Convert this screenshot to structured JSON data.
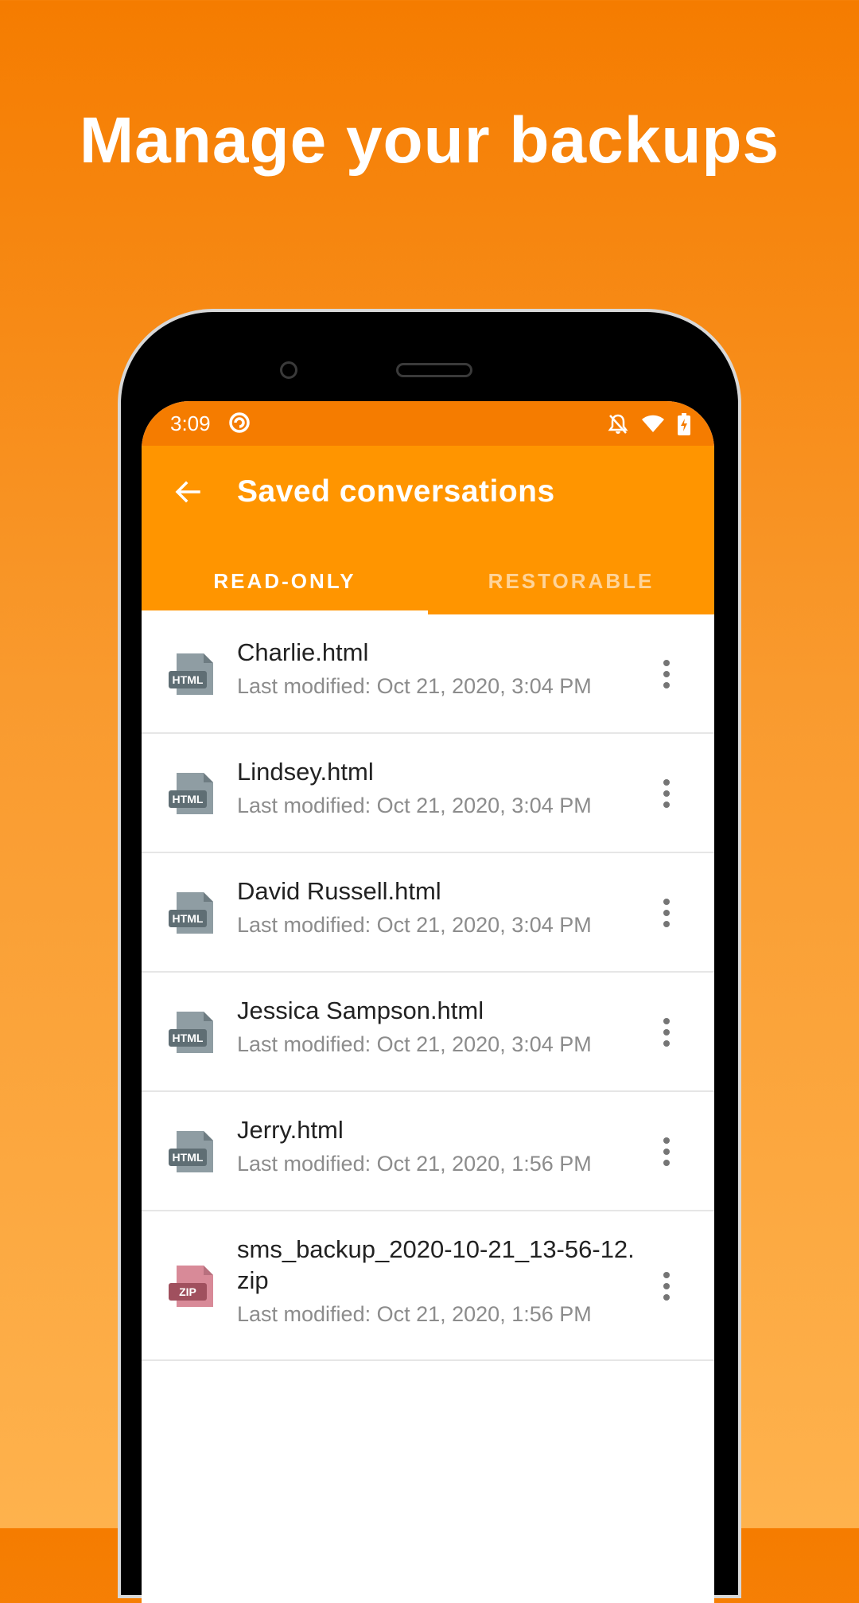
{
  "promo": {
    "headline": "Manage your backups"
  },
  "status_bar": {
    "time": "3:09",
    "icons": [
      "sync-icon",
      "bell-off-icon",
      "wifi-icon",
      "battery-charging-icon"
    ]
  },
  "app_bar": {
    "title": "Saved conversations",
    "back_icon": "arrow-back-icon"
  },
  "tabs": [
    {
      "label": "READ-ONLY",
      "active": true
    },
    {
      "label": "RESTORABLE",
      "active": false
    }
  ],
  "files": [
    {
      "name": "Charlie.html",
      "modified": "Last modified: Oct 21, 2020, 3:04 PM",
      "type_label": "HTML"
    },
    {
      "name": "Lindsey.html",
      "modified": "Last modified: Oct 21, 2020, 3:04 PM",
      "type_label": "HTML"
    },
    {
      "name": "David Russell.html",
      "modified": "Last modified: Oct 21, 2020, 3:04 PM",
      "type_label": "HTML"
    },
    {
      "name": "Jessica Sampson.html",
      "modified": "Last modified: Oct 21, 2020, 3:04 PM",
      "type_label": "HTML"
    },
    {
      "name": "Jerry.html",
      "modified": "Last modified: Oct 21, 2020, 1:56 PM",
      "type_label": "HTML"
    },
    {
      "name": "sms_backup_2020-10-21_13-56-12.zip",
      "modified": "Last modified: Oct 21, 2020, 1:56 PM",
      "type_label": "ZIP"
    }
  ],
  "colors": {
    "accent": "#FF9500",
    "status_bar": "#F57C00",
    "html_icon": "#8F9DA3",
    "html_badge": "#5F6E74",
    "zip_icon": "#D88A98",
    "zip_badge": "#A0505E",
    "secondary_text": "#8C8C8C"
  }
}
